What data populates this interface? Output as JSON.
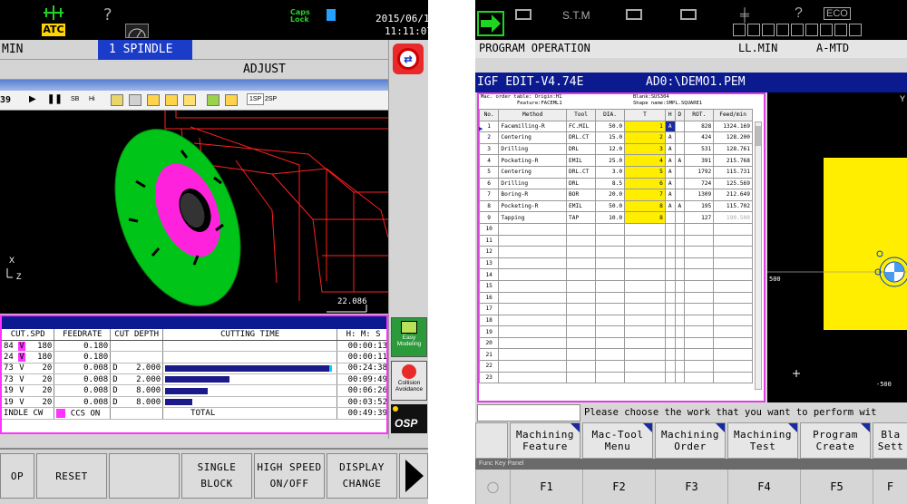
{
  "left": {
    "header": {
      "atc_label": "ATC",
      "question_mark": "?",
      "caps_lock": "Caps\nLock",
      "date": "2015/06/16",
      "time": "11:11:07"
    },
    "mode_row": {
      "feed_unit": "MIN",
      "spindle": "1 SPINDLE"
    },
    "title": "ADJUST",
    "toolbar": {
      "time": "39",
      "sb": "SB",
      "hi": "Hi",
      "spindle1": "1SP",
      "spindle2": "2SP"
    },
    "viewport": {
      "axis_x": "X",
      "axis_z": "Z",
      "scale": "22.086"
    },
    "table": {
      "headers": [
        "CUT.SPD",
        "FEEDRATE",
        "CUT DEPTH",
        "CUTTING TIME",
        "H: M: S"
      ],
      "rows": [
        {
          "num": "84",
          "cv": "V",
          "spd": "180",
          "feed": "0.180",
          "dcode": "",
          "depth": "",
          "bar": 0,
          "time": "00:00:13"
        },
        {
          "num": "24",
          "cv": "V",
          "spd": "180",
          "feed": "0.180",
          "dcode": "",
          "depth": "",
          "bar": 0,
          "time": "00:00:11"
        },
        {
          "num": "73",
          "cv": "V",
          "spd": "20",
          "feed": "0.008",
          "dcode": "D",
          "depth": "2.000",
          "bar": 0.99,
          "time": "00:24:38"
        },
        {
          "num": "73",
          "cv": "V",
          "spd": "20",
          "feed": "0.008",
          "dcode": "D",
          "depth": "2.000",
          "bar": 0.38,
          "time": "00:09:49"
        },
        {
          "num": "19",
          "cv": "V",
          "spd": "20",
          "feed": "0.008",
          "dcode": "D",
          "depth": "8.000",
          "bar": 0.25,
          "time": "00:06:26"
        },
        {
          "num": "19",
          "cv": "V",
          "spd": "20",
          "feed": "0.008",
          "dcode": "D",
          "depth": "8.000",
          "bar": 0.16,
          "time": "00:03:52"
        }
      ],
      "footer": {
        "spindle": "INDLE CW",
        "ccs": "CCS ON",
        "total_label": "TOTAL",
        "total_time": "00:49:39"
      }
    },
    "side": {
      "easy_modeling": "Easy\nModeling",
      "collision": "Collision\nAvoidance",
      "osp": "OSP"
    },
    "fkeys": [
      "OP",
      "RESET",
      "",
      "SINGLE\nBLOCK",
      "HIGH SPEED\nON/OFF",
      "DISPLAY\nCHANGE"
    ]
  },
  "right": {
    "header": {
      "stm": "S.T.M",
      "question_mark": "?",
      "eco": "ECO"
    },
    "mode_row": {
      "title": "PROGRAM OPERATION",
      "feed_unit": "LL.MIN",
      "mtd": "A-MTD"
    },
    "blue_bar": {
      "app": "IGF EDIT-V4.74E",
      "path": "AD0:\\DEMO1.PEM"
    },
    "info": {
      "line1": "Mac. order table: Origin:H1",
      "blank": "Blank:SUS304",
      "feature": "Feature:FACEML1",
      "shape": "Shape name:SMPL.SQUARE1"
    },
    "table": {
      "headers": [
        "No.",
        "Method",
        "Tool",
        "DIA.",
        "T",
        "H",
        "D",
        "ROT.",
        "Feed/min"
      ],
      "rows": [
        {
          "no": "1",
          "method": "Facemilling-R",
          "tool": "FC.MIL",
          "dia": "50.0",
          "t": "1",
          "h": "A",
          "d": "",
          "rot": "828",
          "feed": "1324.169"
        },
        {
          "no": "2",
          "method": "Centering",
          "tool": "DRL.CT",
          "dia": "15.0",
          "t": "2",
          "h": "A",
          "d": "",
          "rot": "424",
          "feed": "128.200"
        },
        {
          "no": "3",
          "method": "Drilling",
          "tool": "DRL",
          "dia": "12.0",
          "t": "3",
          "h": "A",
          "d": "",
          "rot": "531",
          "feed": "128.761"
        },
        {
          "no": "4",
          "method": "Pocketing-R",
          "tool": "EMIL",
          "dia": "25.0",
          "t": "4",
          "h": "A",
          "d": "A",
          "rot": "391",
          "feed": "215.768"
        },
        {
          "no": "5",
          "method": "Centering",
          "tool": "DRL.CT",
          "dia": "3.0",
          "t": "5",
          "h": "A",
          "d": "",
          "rot": "1792",
          "feed": "115.731"
        },
        {
          "no": "6",
          "method": "Drilling",
          "tool": "DRL",
          "dia": "8.5",
          "t": "6",
          "h": "A",
          "d": "",
          "rot": "724",
          "feed": "125.569"
        },
        {
          "no": "7",
          "method": "Boring-R",
          "tool": "BOR",
          "dia": "20.0",
          "t": "7",
          "h": "A",
          "d": "",
          "rot": "1309",
          "feed": "212.649"
        },
        {
          "no": "8",
          "method": "Pocketing-R",
          "tool": "EMIL",
          "dia": "50.0",
          "t": "8",
          "h": "A",
          "d": "A",
          "rot": "195",
          "feed": "115.702"
        },
        {
          "no": "9",
          "method": "Tapping",
          "tool": "TAP",
          "dia": "10.0",
          "t": "8",
          "h": "",
          "d": "",
          "rot": "127",
          "feed": "190.500"
        }
      ],
      "empty_rows": [
        "10",
        "11",
        "12",
        "13",
        "14",
        "15",
        "16",
        "17",
        "18",
        "19",
        "20",
        "21",
        "22",
        "23"
      ]
    },
    "viewport": {
      "y_label": "Y",
      "tick_500": "500",
      "tick_500b": "500",
      "tick_neg500": "-500"
    },
    "message": "Please choose the work that you want to perform wit",
    "fkeys": [
      "Machining\nFeature",
      "Mac-Tool\nMenu",
      "Machining\nOrder",
      "Machining\nTest",
      "Program\nCreate",
      "Bla\nSett"
    ],
    "func_panel_label": "Func Key Panel",
    "fnums": [
      "F1",
      "F2",
      "F3",
      "F4",
      "F5",
      "F"
    ]
  },
  "colors": {
    "accent_blue": "#0c1a90",
    "highlight_magenta": "#ff33ff",
    "yellow": "#ffee00",
    "green": "#00e020"
  }
}
